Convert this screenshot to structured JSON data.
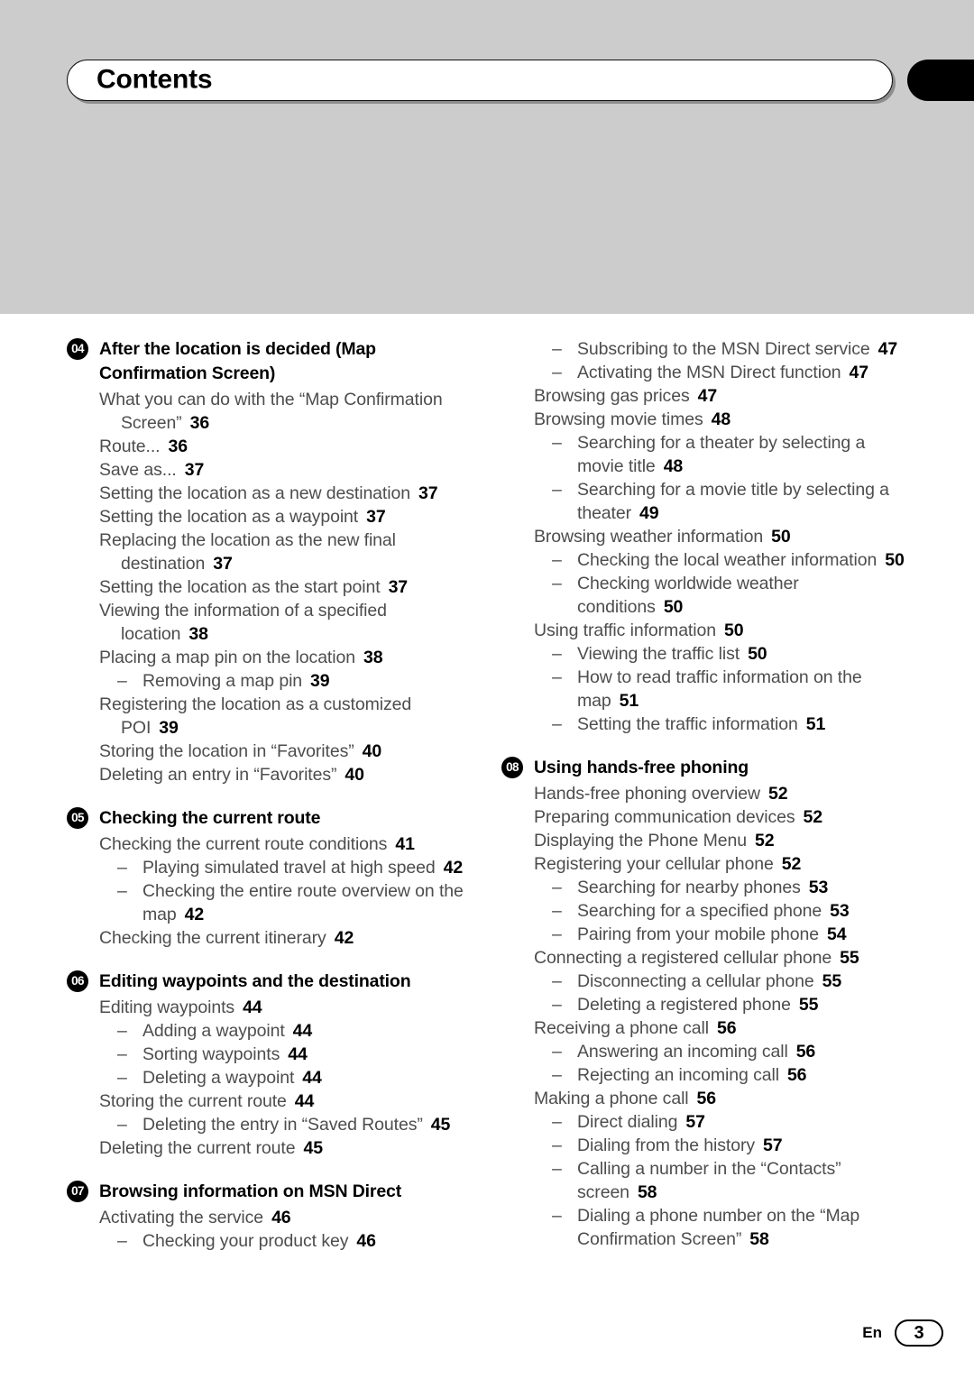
{
  "header": {
    "title": "Contents",
    "background_color": "#cccccc",
    "tab_color": "#000000"
  },
  "footer": {
    "language": "En",
    "page_number": "3"
  },
  "columns": [
    {
      "name": "left",
      "blocks": [
        {
          "type": "chapter",
          "number": "04",
          "title": "After the location is decided (Map Confirmation Screen)"
        },
        {
          "type": "entry",
          "level": 1,
          "text": "What you can do with the “Map Confirmation Screen”",
          "page": "36"
        },
        {
          "type": "entry",
          "level": 1,
          "text": "Route...",
          "page": "36"
        },
        {
          "type": "entry",
          "level": 1,
          "text": "Save as...",
          "page": "37"
        },
        {
          "type": "entry",
          "level": 1,
          "text": "Setting the location as a new destination",
          "page": "37"
        },
        {
          "type": "entry",
          "level": 1,
          "text": "Setting the location as a waypoint",
          "page": "37"
        },
        {
          "type": "entry",
          "level": 1,
          "text": "Replacing the location as the new final destination",
          "page": "37"
        },
        {
          "type": "entry",
          "level": 1,
          "text": "Setting the location as the start point",
          "page": "37"
        },
        {
          "type": "entry",
          "level": 1,
          "text": "Viewing the information of a specified location",
          "page": "38"
        },
        {
          "type": "entry",
          "level": 1,
          "text": "Placing a map pin on the location",
          "page": "38"
        },
        {
          "type": "entry",
          "level": 2,
          "text": "Removing a map pin",
          "page": "39"
        },
        {
          "type": "entry",
          "level": 1,
          "text": "Registering the location as a customized POI",
          "page": "39"
        },
        {
          "type": "entry",
          "level": 1,
          "text": "Storing the location in “Favorites”",
          "page": "40"
        },
        {
          "type": "entry",
          "level": 1,
          "text": "Deleting an entry in “Favorites”",
          "page": "40"
        },
        {
          "type": "chapter",
          "number": "05",
          "title": "Checking the current route"
        },
        {
          "type": "entry",
          "level": 1,
          "text": "Checking the current route conditions",
          "page": "41"
        },
        {
          "type": "entry",
          "level": 2,
          "text": "Playing simulated travel at high speed",
          "page": "42"
        },
        {
          "type": "entry",
          "level": 2,
          "text": "Checking the entire route overview on the map",
          "page": "42"
        },
        {
          "type": "entry",
          "level": 1,
          "text": "Checking the current itinerary",
          "page": "42"
        },
        {
          "type": "chapter",
          "number": "06",
          "title": "Editing waypoints and the destination"
        },
        {
          "type": "entry",
          "level": 1,
          "text": "Editing waypoints",
          "page": "44"
        },
        {
          "type": "entry",
          "level": 2,
          "text": "Adding a waypoint",
          "page": "44"
        },
        {
          "type": "entry",
          "level": 2,
          "text": "Sorting waypoints",
          "page": "44"
        },
        {
          "type": "entry",
          "level": 2,
          "text": "Deleting a waypoint",
          "page": "44"
        },
        {
          "type": "entry",
          "level": 1,
          "text": "Storing the current route",
          "page": "44"
        },
        {
          "type": "entry",
          "level": 2,
          "text": "Deleting the entry in “Saved Routes”",
          "page": "45"
        },
        {
          "type": "entry",
          "level": 1,
          "text": "Deleting the current route",
          "page": "45"
        },
        {
          "type": "chapter",
          "number": "07",
          "title": "Browsing information on MSN Direct"
        },
        {
          "type": "entry",
          "level": 1,
          "text": "Activating the service",
          "page": "46"
        },
        {
          "type": "entry",
          "level": 2,
          "text": "Checking your product key",
          "page": "46"
        }
      ]
    },
    {
      "name": "right",
      "blocks": [
        {
          "type": "entry",
          "level": 2,
          "text": "Subscribing to the MSN Direct service",
          "page": "47"
        },
        {
          "type": "entry",
          "level": 2,
          "text": "Activating the MSN Direct function",
          "page": "47"
        },
        {
          "type": "entry",
          "level": 1,
          "text": "Browsing gas prices",
          "page": "47"
        },
        {
          "type": "entry",
          "level": 1,
          "text": "Browsing movie times",
          "page": "48"
        },
        {
          "type": "entry",
          "level": 2,
          "text": "Searching for a theater by selecting a movie title",
          "page": "48"
        },
        {
          "type": "entry",
          "level": 2,
          "text": "Searching for a movie title by selecting a theater",
          "page": "49"
        },
        {
          "type": "entry",
          "level": 1,
          "text": "Browsing weather information",
          "page": "50"
        },
        {
          "type": "entry",
          "level": 2,
          "text": "Checking the local weather information",
          "page": "50"
        },
        {
          "type": "entry",
          "level": 2,
          "text": "Checking worldwide weather conditions",
          "page": "50"
        },
        {
          "type": "entry",
          "level": 1,
          "text": "Using traffic information",
          "page": "50"
        },
        {
          "type": "entry",
          "level": 2,
          "text": "Viewing the traffic list",
          "page": "50"
        },
        {
          "type": "entry",
          "level": 2,
          "text": "How to read traffic information on the map",
          "page": "51"
        },
        {
          "type": "entry",
          "level": 2,
          "text": "Setting the traffic information",
          "page": "51"
        },
        {
          "type": "chapter",
          "number": "08",
          "title": "Using hands-free phoning"
        },
        {
          "type": "entry",
          "level": 1,
          "text": "Hands-free phoning overview",
          "page": "52"
        },
        {
          "type": "entry",
          "level": 1,
          "text": "Preparing communication devices",
          "page": "52"
        },
        {
          "type": "entry",
          "level": 1,
          "text": "Displaying the Phone Menu",
          "page": "52"
        },
        {
          "type": "entry",
          "level": 1,
          "text": "Registering your cellular phone",
          "page": "52"
        },
        {
          "type": "entry",
          "level": 2,
          "text": "Searching for nearby phones",
          "page": "53"
        },
        {
          "type": "entry",
          "level": 2,
          "text": "Searching for a specified phone",
          "page": "53"
        },
        {
          "type": "entry",
          "level": 2,
          "text": "Pairing from your mobile phone",
          "page": "54"
        },
        {
          "type": "entry",
          "level": 1,
          "text": "Connecting a registered cellular phone",
          "page": "55"
        },
        {
          "type": "entry",
          "level": 2,
          "text": "Disconnecting a cellular phone",
          "page": "55"
        },
        {
          "type": "entry",
          "level": 2,
          "text": "Deleting a registered phone",
          "page": "55"
        },
        {
          "type": "entry",
          "level": 1,
          "text": "Receiving a phone call",
          "page": "56"
        },
        {
          "type": "entry",
          "level": 2,
          "text": "Answering an incoming call",
          "page": "56"
        },
        {
          "type": "entry",
          "level": 2,
          "text": "Rejecting an incoming call",
          "page": "56"
        },
        {
          "type": "entry",
          "level": 1,
          "text": "Making a phone call",
          "page": "56"
        },
        {
          "type": "entry",
          "level": 2,
          "text": "Direct dialing",
          "page": "57"
        },
        {
          "type": "entry",
          "level": 2,
          "text": "Dialing from the history",
          "page": "57"
        },
        {
          "type": "entry",
          "level": 2,
          "text": "Calling a number in the “Contacts” screen",
          "page": "58"
        },
        {
          "type": "entry",
          "level": 2,
          "text": "Dialing a phone number on the “Map Confirmation Screen”",
          "page": "58"
        }
      ]
    }
  ]
}
